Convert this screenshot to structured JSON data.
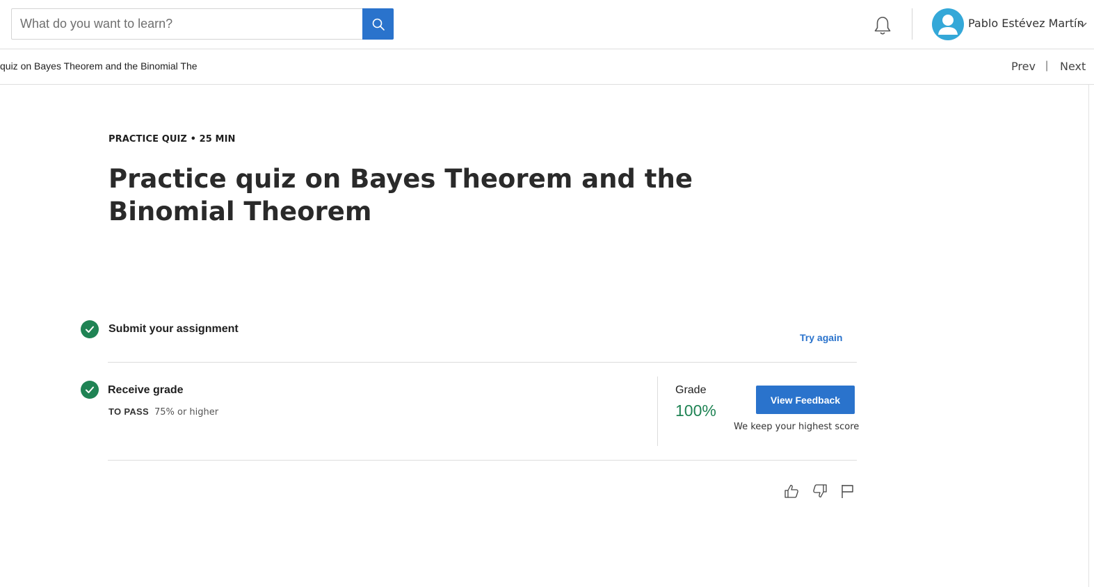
{
  "header": {
    "search": {
      "placeholder": "What do you want to learn?",
      "value": ""
    },
    "user": {
      "name": "Pablo Estévez Martín"
    }
  },
  "subnav": {
    "breadcrumb": "quiz on Bayes Theorem and the Binomial Theor",
    "prev_label": "Prev",
    "separator": "|",
    "next_label": "Next"
  },
  "quiz": {
    "meta": "PRACTICE QUIZ • 25 MIN",
    "title": "Practice quiz on Bayes Theorem and the Binomial Theorem"
  },
  "steps": {
    "submit": {
      "title": "Submit your assignment",
      "action_label": "Try again"
    },
    "grade": {
      "title": "Receive grade",
      "pass_label": "TO PASS",
      "pass_value": "75% or higher",
      "grade_label": "Grade",
      "grade_value": "100%",
      "feedback_button": "View Feedback",
      "note": "We keep your highest score"
    }
  },
  "colors": {
    "accent": "#2a73cc",
    "success": "#1f8354",
    "avatar": "#34a8d8"
  },
  "icons": [
    "search-icon",
    "bell-icon",
    "user-avatar-icon",
    "chevron-down-icon",
    "check-icon",
    "thumbs-up-icon",
    "thumbs-down-icon",
    "flag-icon"
  ]
}
